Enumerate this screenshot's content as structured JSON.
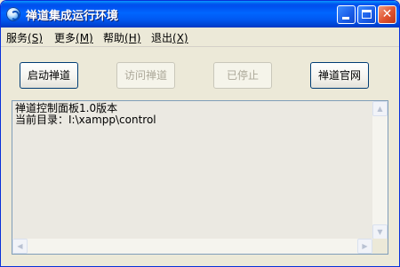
{
  "window": {
    "title": "禅道集成运行环境",
    "controls": {
      "minimize": "",
      "maximize": "",
      "close": "✕"
    }
  },
  "menu": [
    {
      "label": "服务",
      "key": "(S)",
      "name": "menu-service"
    },
    {
      "label": "更多",
      "key": "(M)",
      "name": "menu-more"
    },
    {
      "label": "帮助",
      "key": "(H)",
      "name": "menu-help"
    },
    {
      "label": "退出",
      "key": "(X)",
      "name": "menu-exit"
    }
  ],
  "buttons": {
    "start": {
      "label": "启动禅道",
      "enabled": true
    },
    "visit": {
      "label": "访问禅道",
      "enabled": false
    },
    "stop": {
      "label": "已停止",
      "enabled": false
    },
    "site": {
      "label": "禅道官网",
      "enabled": true
    }
  },
  "console": {
    "lines": [
      "禅道控制面板1.0版本",
      "当前目录：I:\\xampp\\control"
    ]
  },
  "scroll_glyphs": {
    "up": "▲",
    "down": "▼",
    "left": "◀",
    "right": "▶"
  }
}
